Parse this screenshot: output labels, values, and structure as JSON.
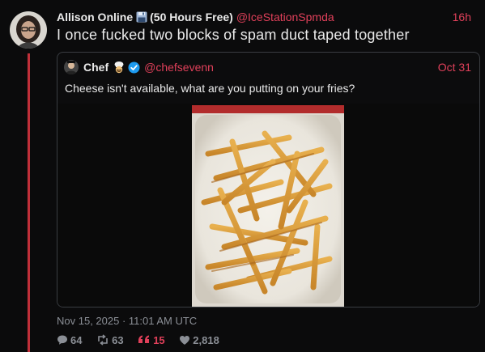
{
  "author": {
    "display_name": "Allison Online",
    "name_suffix": "(50 Hours Free)",
    "handle": "@IceStationSpmda",
    "time": "16h"
  },
  "post": {
    "text": "I once fucked two blocks of spam duct taped together",
    "date": "Nov 15, 2025 · 11:01 AM UTC"
  },
  "quote": {
    "display_name": "Chef",
    "handle": "@chefsevenn",
    "date": "Oct 31",
    "text": "Cheese isn't available, what are you putting on your fries?"
  },
  "stats": {
    "replies": "64",
    "reposts": "63",
    "quotes": "15",
    "likes": "2,818"
  },
  "colors": {
    "accent": "#e0405a",
    "thread": "#c0303a",
    "muted": "#8b8f96",
    "verified": "#1d9bf0"
  }
}
